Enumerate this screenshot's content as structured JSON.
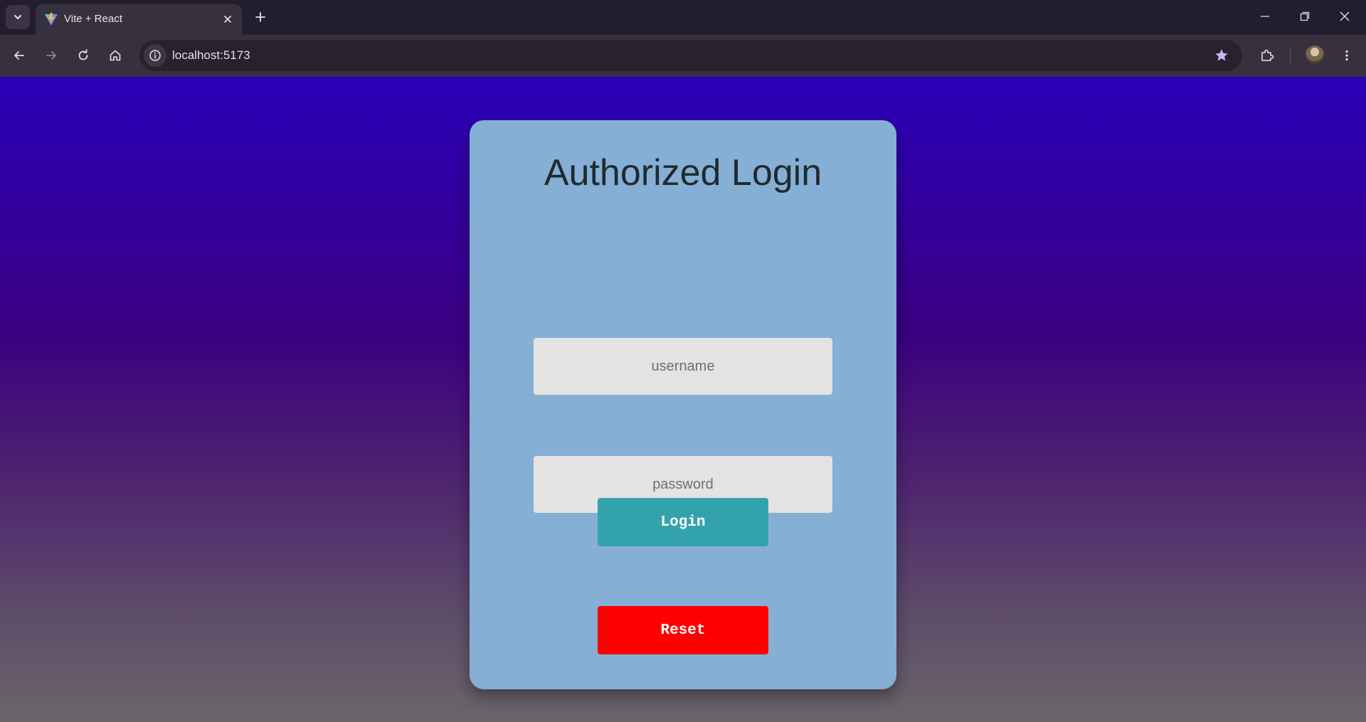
{
  "browser": {
    "tab": {
      "title": "Vite + React",
      "favicon": "vite-logo-icon"
    },
    "url": "localhost:5173",
    "icons": {
      "tab_search": "chevron-down-icon",
      "close_tab": "close-icon",
      "new_tab": "plus-icon",
      "minimize": "minimize-icon",
      "restore": "restore-icon",
      "close_window": "close-icon",
      "back": "arrow-left-icon",
      "forward": "arrow-right-icon",
      "reload": "reload-icon",
      "home": "home-icon",
      "site_info": "info-icon",
      "bookmark": "star-icon",
      "extensions": "puzzle-icon",
      "profile": "avatar",
      "menu": "kebab-menu-icon"
    }
  },
  "login": {
    "title": "Authorized Login",
    "username_placeholder": "username",
    "username_value": "",
    "password_placeholder": "password",
    "password_value": "",
    "login_label": "Login",
    "reset_label": "Reset"
  },
  "colors": {
    "background_top": "#2a00b9",
    "background_bottom": "#6b6569",
    "card": "#85afd4",
    "login_button": "#33a3ab",
    "reset_button": "#ff0000",
    "bookmark_star": "#c9b3ff"
  }
}
